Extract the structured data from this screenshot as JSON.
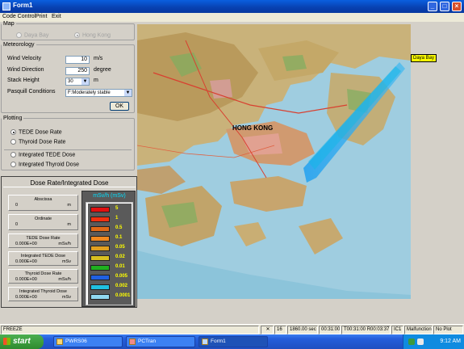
{
  "window": {
    "title": "Form1"
  },
  "menu": {
    "items": [
      "Code Control",
      "Print",
      "Exit"
    ]
  },
  "map_group": {
    "legend": "Map",
    "options": [
      {
        "label": "Daya Bay",
        "selected": false
      },
      {
        "label": "Hong Kong",
        "selected": true
      }
    ]
  },
  "meteorology": {
    "legend": "Meteorology",
    "fields": [
      {
        "label": "Wind Velocity",
        "value": "10",
        "unit": "m/s"
      },
      {
        "label": "Wind Direction",
        "value": "250",
        "unit": "degree"
      },
      {
        "label": "Stack Height",
        "value": "30",
        "unit": "m"
      }
    ],
    "pasquill_label": "Pasquill Conditions",
    "pasquill_value": "F:Moderately stable",
    "ok_label": "OK"
  },
  "plotting": {
    "legend": "Plotting",
    "options": [
      {
        "label": "TEDE Dose Rate",
        "selected": true
      },
      {
        "label": "Thyroid Dose Rate",
        "selected": false
      },
      {
        "label": "Integrated TEDE Dose",
        "selected": false
      },
      {
        "label": "Integrated Thyroid Dose",
        "selected": false
      }
    ]
  },
  "dose_panel": {
    "title": "Dose Rate/Integrated Dose",
    "readouts": [
      {
        "label": "Abscissa",
        "value": "0",
        "unit": "m"
      },
      {
        "label": "Ordinate",
        "value": "0",
        "unit": "m"
      },
      {
        "label": "TEDE Dose Rate",
        "value": "0.000E+00",
        "unit": "mSv/h"
      },
      {
        "label": "Integrated TEDE Dose",
        "value": "0.000E+00",
        "unit": "mSv"
      },
      {
        "label": "Thyroid Dose Rate",
        "value": "0.000E+00",
        "unit": "mSv/h"
      },
      {
        "label": "Integrated Thyroid Dose",
        "value": "0.000E+00",
        "unit": "mSv"
      }
    ],
    "legend_title": "mSv/h (mSv)",
    "scale": [
      {
        "label": "5",
        "color": "#e01010"
      },
      {
        "label": "1",
        "color": "#f03010"
      },
      {
        "label": "0.5",
        "color": "#e06818"
      },
      {
        "label": "0.1",
        "color": "#f08820"
      },
      {
        "label": "0.05",
        "color": "#e0a020"
      },
      {
        "label": "0.02",
        "color": "#d8c020"
      },
      {
        "label": "0.01",
        "color": "#20b020"
      },
      {
        "label": "0.005",
        "color": "#2060e0"
      },
      {
        "label": "0.002",
        "color": "#20c0e0"
      },
      {
        "label": "0.0001",
        "color": "#90d8f0"
      }
    ]
  },
  "map": {
    "site_label": "Daya Bay",
    "city_label": "HONG KONG"
  },
  "statusbar": {
    "mode": "FREEZE",
    "count": "16",
    "elapsed": "1860.00 sec",
    "clock_time": "00:31:00",
    "timer": "T00:31:00 R00:03:37",
    "ic": "IC1",
    "malfunction": "Malfunction",
    "plot": "No Plot"
  },
  "taskbar": {
    "start_label": "start",
    "tasks": [
      "PWRS06",
      "PCTran",
      "Form1"
    ],
    "clock": "9:12 AM"
  }
}
